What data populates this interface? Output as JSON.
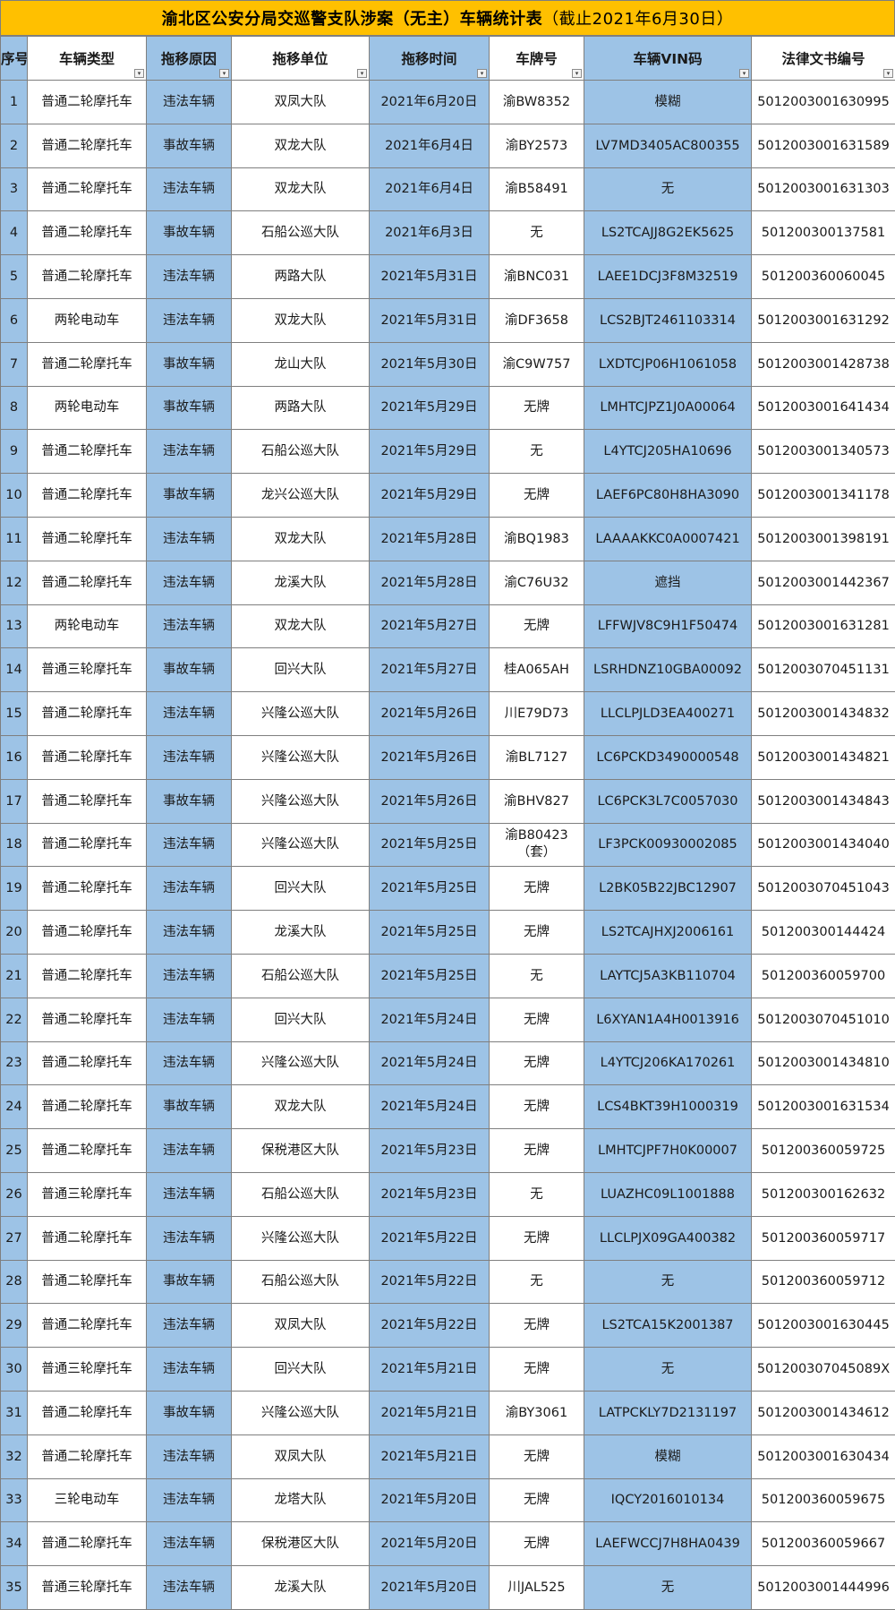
{
  "title": {
    "main": "渝北区公安分局交巡警支队涉案（无主）车辆统计表",
    "sub": "（截止2021年6月30日）"
  },
  "headers": [
    "序号",
    "车辆类型",
    "拖移原因",
    "拖移单位",
    "拖移时间",
    "车牌号",
    "车辆VIN码",
    "法律文书编号"
  ],
  "colors": {
    "title_bg": "#ffc000",
    "blue_col": "#9dc3e6",
    "border": "#7f7f7f"
  },
  "rows": [
    [
      "1",
      "普通二轮摩托车",
      "违法车辆",
      "双凤大队",
      "2021年6月20日",
      "渝BW8352",
      "模糊",
      "5012003001630995"
    ],
    [
      "2",
      "普通二轮摩托车",
      "事故车辆",
      "双龙大队",
      "2021年6月4日",
      "渝BY2573",
      "LV7MD3405AC800355",
      "5012003001631589"
    ],
    [
      "3",
      "普通二轮摩托车",
      "违法车辆",
      "双龙大队",
      "2021年6月4日",
      "渝B58491",
      "无",
      "5012003001631303"
    ],
    [
      "4",
      "普通二轮摩托车",
      "事故车辆",
      "石船公巡大队",
      "2021年6月3日",
      "无",
      "LS2TCAJJ8G2EK5625",
      "501200300137581"
    ],
    [
      "5",
      "普通二轮摩托车",
      "违法车辆",
      "两路大队",
      "2021年5月31日",
      "渝BNC031",
      "LAEE1DCJ3F8M32519",
      "501200360060045"
    ],
    [
      "6",
      "两轮电动车",
      "违法车辆",
      "双龙大队",
      "2021年5月31日",
      "渝DF3658",
      "LCS2BJT2461103314",
      "5012003001631292"
    ],
    [
      "7",
      "普通二轮摩托车",
      "事故车辆",
      "龙山大队",
      "2021年5月30日",
      "渝C9W757",
      "LXDTCJP06H1061058",
      "5012003001428738"
    ],
    [
      "8",
      "两轮电动车",
      "事故车辆",
      "两路大队",
      "2021年5月29日",
      "无牌",
      "LMHTCJPZ1J0A00064",
      "5012003001641434"
    ],
    [
      "9",
      "普通二轮摩托车",
      "违法车辆",
      "石船公巡大队",
      "2021年5月29日",
      "无",
      "L4YTCJ205HA10696",
      "5012003001340573"
    ],
    [
      "10",
      "普通二轮摩托车",
      "事故车辆",
      "龙兴公巡大队",
      "2021年5月29日",
      "无牌",
      "LAEF6PC80H8HA3090",
      "5012003001341178"
    ],
    [
      "11",
      "普通二轮摩托车",
      "违法车辆",
      "双龙大队",
      "2021年5月28日",
      "渝BQ1983",
      "LAAAAKKC0A0007421",
      "5012003001398191"
    ],
    [
      "12",
      "普通二轮摩托车",
      "违法车辆",
      "龙溪大队",
      "2021年5月28日",
      "渝C76U32",
      "遮挡",
      "5012003001442367"
    ],
    [
      "13",
      "两轮电动车",
      "违法车辆",
      "双龙大队",
      "2021年5月27日",
      "无牌",
      "LFFWJV8C9H1F50474",
      "5012003001631281"
    ],
    [
      "14",
      "普通三轮摩托车",
      "事故车辆",
      "回兴大队",
      "2021年5月27日",
      "桂A065AH",
      "LSRHDNZ10GBA00092",
      "50120030704511​31"
    ],
    [
      "15",
      "普通二轮摩托车",
      "违法车辆",
      "兴隆公巡大队",
      "2021年5月26日",
      "川E79D73",
      "LLCLPJLD3EA400271",
      "5012003001434832"
    ],
    [
      "16",
      "普通二轮摩托车",
      "违法车辆",
      "兴隆公巡大队",
      "2021年5月26日",
      "渝BL7127",
      "LC6PCKD3490000548",
      "5012003001434821"
    ],
    [
      "17",
      "普通二轮摩托车",
      "事故车辆",
      "兴隆公巡大队",
      "2021年5月26日",
      "渝BHV827",
      "LC6PCK3L7C0057030",
      "5012003001434843"
    ],
    [
      "18",
      "普通二轮摩托车",
      "违法车辆",
      "兴隆公巡大队",
      "2021年5月25日",
      "渝B80423（套）",
      "LF3PCK00930002085",
      "5012003001434040"
    ],
    [
      "19",
      "普通二轮摩托车",
      "违法车辆",
      "回兴大队",
      "2021年5月25日",
      "无牌",
      "L2BK05B22JBC12907",
      "5012003070451043"
    ],
    [
      "20",
      "普通二轮摩托车",
      "违法车辆",
      "龙溪大队",
      "2021年5月25日",
      "无牌",
      "LS2TCAJHXJ2006161",
      "501200300144424"
    ],
    [
      "21",
      "普通二轮摩托车",
      "违法车辆",
      "石船公巡大队",
      "2021年5月25日",
      "无",
      "LAYTCJ5A3KB110704",
      "501200360059700"
    ],
    [
      "22",
      "普通二轮摩托车",
      "违法车辆",
      "回兴大队",
      "2021年5月24日",
      "无牌",
      "L6XYAN1A4H0013916",
      "5012003070451010"
    ],
    [
      "23",
      "普通二轮摩托车",
      "违法车辆",
      "兴隆公巡大队",
      "2021年5月24日",
      "无牌",
      "L4YTCJ206KA170261",
      "5012003001434810"
    ],
    [
      "24",
      "普通二轮摩托车",
      "事故车辆",
      "双龙大队",
      "2021年5月24日",
      "无牌",
      "LCS4BKT39H1000319",
      "5012003001631534"
    ],
    [
      "25",
      "普通二轮摩托车",
      "违法车辆",
      "保税港区大队",
      "2021年5月23日",
      "无牌",
      "LMHTCJPF7H0K00007",
      "501200360059725"
    ],
    [
      "26",
      "普通三轮摩托车",
      "违法车辆",
      "石船公巡大队",
      "2021年5月23日",
      "无",
      "LUAZHC09L1001888",
      "501200300162632"
    ],
    [
      "27",
      "普通二轮摩托车",
      "违法车辆",
      "兴隆公巡大队",
      "2021年5月22日",
      "无牌",
      "LLCLPJX09GA400382",
      "501200360059717"
    ],
    [
      "28",
      "普通二轮摩托车",
      "事故车辆",
      "石船公巡大队",
      "2021年5月22日",
      "无",
      "无",
      "501200360059712"
    ],
    [
      "29",
      "普通二轮摩托车",
      "违法车辆",
      "双凤大队",
      "2021年5月22日",
      "无牌",
      "LS2TCA15K2001387",
      "5012003001630445"
    ],
    [
      "30",
      "普通三轮摩托车",
      "违法车辆",
      "回兴大队",
      "2021年5月21日",
      "无牌",
      "无",
      "501200307045089X"
    ],
    [
      "31",
      "普通二轮摩托车",
      "事故车辆",
      "兴隆公巡大队",
      "2021年5月21日",
      "渝BY3061",
      "LATPCKLY7D2131197",
      "5012003001434612"
    ],
    [
      "32",
      "普通二轮摩托车",
      "违法车辆",
      "双凤大队",
      "2021年5月21日",
      "无牌",
      "模糊",
      "5012003001630434"
    ],
    [
      "33",
      "三轮电动车",
      "违法车辆",
      "龙塔大队",
      "2021年5月20日",
      "无牌",
      "IQCY2016010134",
      "501200360059675"
    ],
    [
      "34",
      "普通二轮摩托车",
      "违法车辆",
      "保税港区大队",
      "2021年5月20日",
      "无牌",
      "LAEFWCCJ7H8HA0439",
      "501200360059667"
    ],
    [
      "35",
      "普通三轮摩托车",
      "违法车辆",
      "龙溪大队",
      "2021年5月20日",
      "川JAL525",
      "无",
      "5012003001444996"
    ]
  ]
}
